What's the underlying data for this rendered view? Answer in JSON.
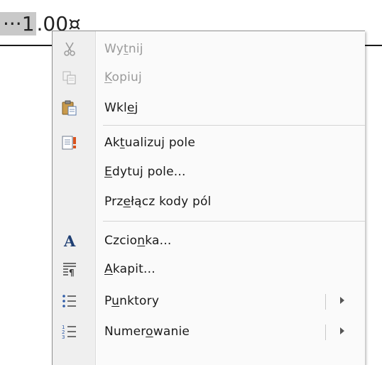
{
  "document": {
    "field_highlight": "···1",
    "field_rest": ".00¤"
  },
  "menu": {
    "items": [
      {
        "id": "cut",
        "pre": "Wy",
        "u": "t",
        "post": "nij",
        "icon": "scissors-icon",
        "enabled": false
      },
      {
        "id": "copy",
        "pre": "",
        "u": "K",
        "post": "opiuj",
        "icon": "copy-icon",
        "enabled": false
      },
      {
        "id": "paste",
        "pre": "Wkl",
        "u": "e",
        "post": "j",
        "icon": "paste-icon",
        "enabled": true
      },
      {
        "id": "update-field",
        "pre": "Ak",
        "u": "t",
        "post": "ualizuj pole",
        "icon": "update-field-icon",
        "enabled": true
      },
      {
        "id": "edit-field",
        "pre": "",
        "u": "E",
        "post": "dytuj pole...",
        "icon": "",
        "enabled": true
      },
      {
        "id": "toggle-field-codes",
        "pre": "Prz",
        "u": "e",
        "post": "łącz kody pól",
        "icon": "",
        "enabled": true
      },
      {
        "id": "font",
        "pre": "Czcio",
        "u": "n",
        "post": "ka...",
        "icon": "font-icon",
        "enabled": true
      },
      {
        "id": "paragraph",
        "pre": "",
        "u": "A",
        "post": "kapit...",
        "icon": "paragraph-icon",
        "enabled": true
      },
      {
        "id": "bullets",
        "pre": "P",
        "u": "u",
        "post": "nktory",
        "icon": "bullets-icon",
        "enabled": true
      },
      {
        "id": "numbering",
        "pre": "Numer",
        "u": "o",
        "post": "wanie",
        "icon": "numbering-icon",
        "enabled": true
      }
    ]
  },
  "colors": {
    "text": "#1a1a1a",
    "disabled_text": "#9a9a9a",
    "menu_bg": "#fafafa",
    "gutter_bg": "#efefef",
    "field_highlight": "#c9c9c9"
  }
}
